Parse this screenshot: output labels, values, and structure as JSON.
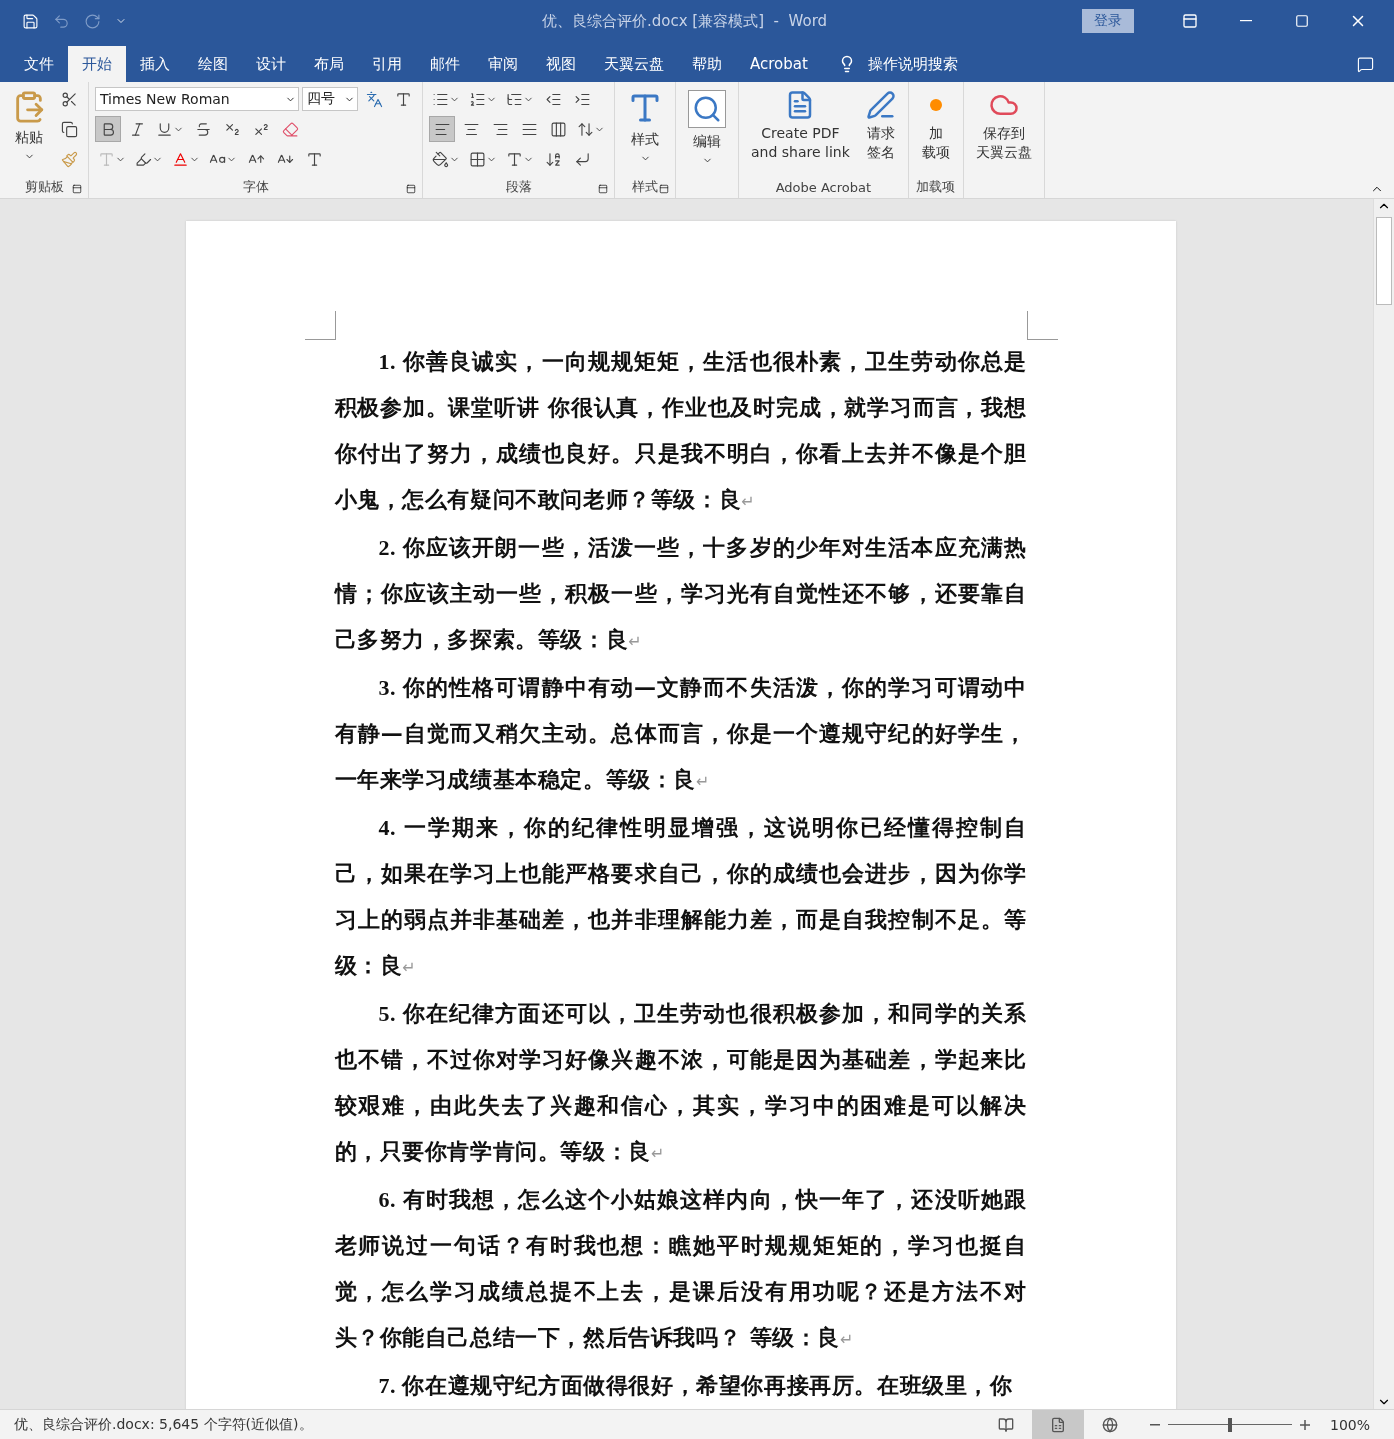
{
  "title_bar": {
    "title": "优、良综合评价.docx [兼容模式]  -  Word",
    "sign_in": "登录"
  },
  "tabs": [
    {
      "label": "文件",
      "selected": false
    },
    {
      "label": "开始",
      "selected": true
    },
    {
      "label": "插入",
      "selected": false
    },
    {
      "label": "绘图",
      "selected": false
    },
    {
      "label": "设计",
      "selected": false
    },
    {
      "label": "布局",
      "selected": false
    },
    {
      "label": "引用",
      "selected": false
    },
    {
      "label": "邮件",
      "selected": false
    },
    {
      "label": "审阅",
      "selected": false
    },
    {
      "label": "视图",
      "selected": false
    },
    {
      "label": "天翼云盘",
      "selected": false
    },
    {
      "label": "帮助",
      "selected": false
    },
    {
      "label": "Acrobat",
      "selected": false
    }
  ],
  "tell_me": "操作说明搜索",
  "ribbon": {
    "clipboard": {
      "paste": "粘贴",
      "label": "剪贴板"
    },
    "font": {
      "name": "Times New Roman",
      "size": "四号",
      "bold": true,
      "label": "字体"
    },
    "paragraph": {
      "alignments": [
        {
          "kind": "left",
          "selected": true
        },
        {
          "kind": "center",
          "selected": false
        },
        {
          "kind": "right",
          "selected": false
        },
        {
          "kind": "justify",
          "selected": false
        }
      ],
      "label": "段落"
    },
    "styles": {
      "button": "样式",
      "label": "样式"
    },
    "editing": {
      "button": "编辑"
    },
    "acrobat": {
      "create": [
        "Create PDF",
        "and share link"
      ],
      "sign": [
        "请求",
        "签名"
      ],
      "label": "Adobe Acrobat"
    },
    "addins": {
      "button": [
        "加",
        "载项"
      ],
      "label": "加载项"
    },
    "cloud": {
      "button": [
        "保存到",
        "天翼云盘"
      ]
    }
  },
  "document": {
    "paragraphs": [
      {
        "number": "1.",
        "text": "你善良诚实，一向规规矩矩，生活也很朴素，卫生劳动你总是积极参加。课堂听讲 你很认真，作业也及时完成，就学习而言，我想你付出了努力，成绩也良好。只是我不明白，你看上去并不像是个胆小鬼，怎么有疑问不敢问老师？等级：良",
        "end_mark": "↵"
      },
      {
        "number": "2.",
        "text": "你应该开朗一些，活泼一些，十多岁的少年对生活本应充满热情；你应该主动一些，积极一些，学习光有自觉性还不够，还要靠自己多努力，多探索。等级：良",
        "end_mark": "↵"
      },
      {
        "number": "3.",
        "text": "你的性格可谓静中有动—文静而不失活泼，你的学习可谓动中有静—自觉而又稍欠主动。总体而言，你是一个遵规守纪的好学生，一年来学习成绩基本稳定。等级：良",
        "end_mark": "↵"
      },
      {
        "number": "4.",
        "text": "一学期来，你的纪律性明显增强，这说明你已经懂得控制自己，如果在学习上也能严格要求自己，你的成绩也会进步，因为你学习上的弱点并非基础差，也并非理解能力差，而是自我控制不足。等级：良",
        "end_mark": "↵"
      },
      {
        "number": "5.",
        "text": "你在纪律方面还可以，卫生劳动也很积极参加，和同学的关系也不错，不过你对学习好像兴趣不浓，可能是因为基础差，学起来比较艰难，由此失去了兴趣和信心，其实，学习中的困难是可以解决的，只要你肯学肯问。等级：良",
        "end_mark": "↵"
      },
      {
        "number": "6.",
        "text": "有时我想，怎么这个小姑娘这样内向，快一年了，还没听她跟老师说过一句话？有时我也想：瞧她平时规规矩矩的，学习也挺自觉，怎么学习成绩总提不上去，是课后没有用功呢？还是方法不对头？你能自己总结一下，然后告诉我吗？ 等级：良",
        "end_mark": "↵"
      },
      {
        "number": "7.",
        "text": "你在遵规守纪方面做得很好，希望你再接再厉。在班级里，你"
      }
    ]
  },
  "status_bar": {
    "text": "优、良综合评价.docx: 5,645 个字符(近似值)。",
    "views": [
      {
        "kind": "read",
        "selected": false
      },
      {
        "kind": "print",
        "selected": true
      },
      {
        "kind": "web",
        "selected": false
      }
    ],
    "zoom": {
      "level": 0.5,
      "reading": "100%"
    }
  }
}
